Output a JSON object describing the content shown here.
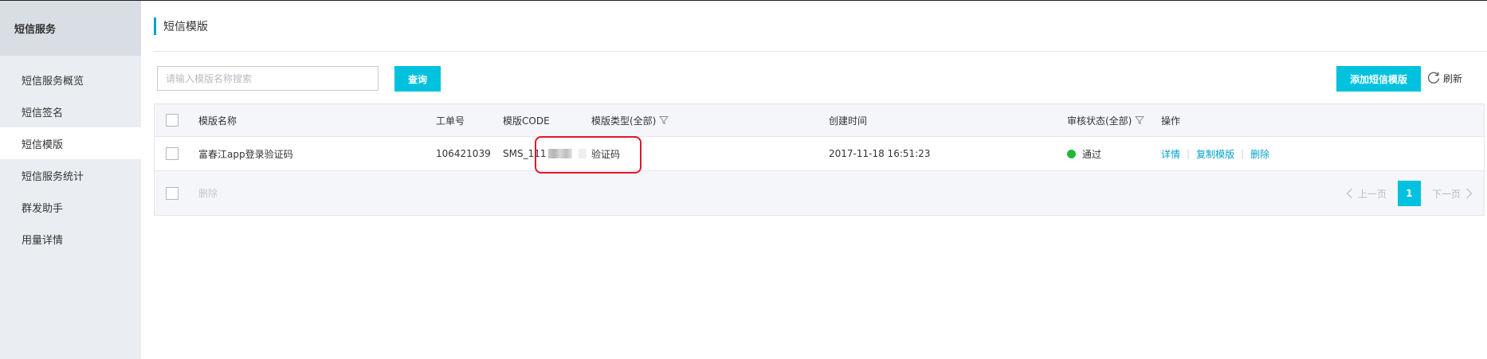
{
  "sidebar": {
    "title": "短信服务",
    "items": [
      {
        "label": "短信服务概览",
        "active": false
      },
      {
        "label": "短信签名",
        "active": false
      },
      {
        "label": "短信模版",
        "active": true
      },
      {
        "label": "短信服务统计",
        "active": false
      },
      {
        "label": "群发助手",
        "active": false
      },
      {
        "label": "用量详情",
        "active": false
      }
    ]
  },
  "main": {
    "page_title": "短信模版",
    "search": {
      "placeholder": "请输入模版名称搜索",
      "value": ""
    },
    "query_label": "查询",
    "add_label": "添加短信模版",
    "refresh_label": "刷新"
  },
  "table": {
    "headers": {
      "name": "模版名称",
      "ticket": "工单号",
      "code": "模版CODE",
      "type": "模版类型(全部)",
      "created": "创建时间",
      "status": "审核状态(全部)",
      "actions": "操作"
    },
    "rows": [
      {
        "name": "富春江app登录验证码",
        "ticket": "106421039",
        "code": "SMS_111",
        "type": "验证码",
        "created": "2017-11-18 16:51:23",
        "status": "通过",
        "actions": [
          "详情",
          "复制模版",
          "删除"
        ]
      }
    ],
    "footer": {
      "delete_label": "删除"
    },
    "pager": {
      "prev_label": "上一页",
      "current": "1",
      "next_label": "下一页"
    }
  },
  "colors": {
    "accent": "#00c1de",
    "link": "#00a2ca",
    "success": "#1db93b",
    "highlight": "#e0182a",
    "sidebar_bg": "#eaedf1"
  }
}
